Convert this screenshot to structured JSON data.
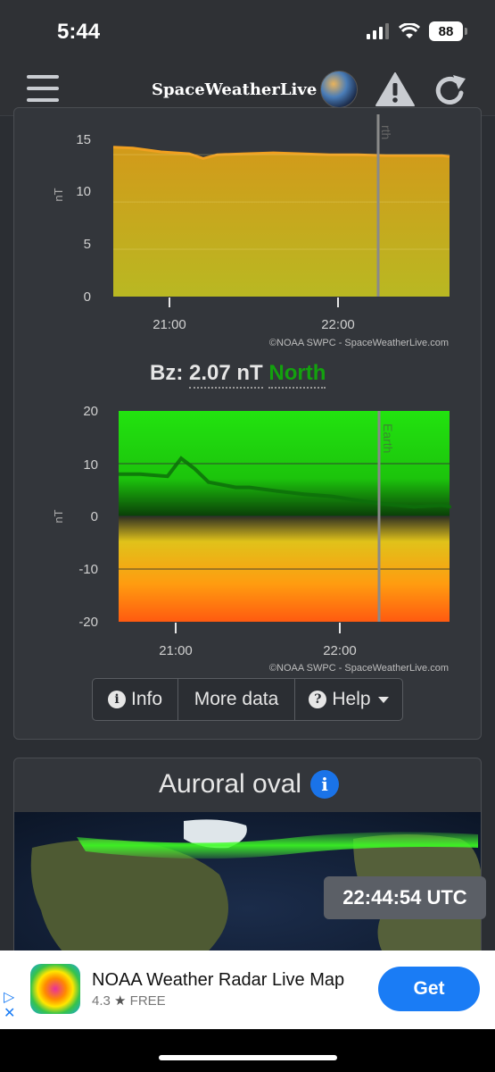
{
  "status_bar": {
    "time": "5:44",
    "battery": "88"
  },
  "header": {
    "brand": "SpaceWeatherLive"
  },
  "bt_chart": {
    "y_ticks": [
      "15",
      "10",
      "5",
      "0"
    ],
    "y_label": "nT",
    "x_ticks": [
      "21:00",
      "22:00"
    ],
    "earth_label": "rth",
    "credit": "©NOAA SWPC - SpaceWeatherLive.com"
  },
  "bz": {
    "label": "Bz:",
    "value": "2.07 nT",
    "direction": "North"
  },
  "bz_chart": {
    "y_ticks": [
      "20",
      "10",
      "0",
      "-10",
      "-20"
    ],
    "y_label": "nT",
    "x_ticks": [
      "21:00",
      "22:00"
    ],
    "earth_label": "Earth",
    "credit": "©NOAA SWPC - SpaceWeatherLive.com"
  },
  "buttons": {
    "info": "Info",
    "more_data": "More data",
    "help": "Help"
  },
  "aurora": {
    "title": "Auroral oval",
    "utc": "22:44:54 UTC"
  },
  "ad": {
    "title": "NOAA Weather Radar Live Map",
    "rating": "4.3",
    "price": "FREE",
    "cta": "Get"
  },
  "chart_data": [
    {
      "type": "area",
      "ylabel": "nT",
      "ylim": [
        0,
        17
      ],
      "x_ticks": [
        "21:00",
        "22:00"
      ],
      "x": [
        "20:37",
        "20:47",
        "20:57",
        "21:07",
        "21:12",
        "21:17",
        "21:27",
        "21:37",
        "21:47",
        "21:57",
        "22:07",
        "22:17",
        "22:27",
        "22:37",
        "22:47",
        "22:55"
      ],
      "series": [
        {
          "values": [
            15.8,
            15.7,
            15.3,
            15.1,
            14.6,
            15.0,
            15.1,
            15.2,
            15.1,
            15.0,
            15.0,
            14.9,
            14.9,
            14.9,
            14.8,
            14.8
          ]
        }
      ],
      "annotations": [
        "rth"
      ]
    },
    {
      "type": "line",
      "ylabel": "nT",
      "ylim": [
        -20,
        20
      ],
      "x_ticks": [
        "21:00",
        "22:00"
      ],
      "x": [
        "20:37",
        "20:47",
        "20:57",
        "21:02",
        "21:07",
        "21:12",
        "21:17",
        "21:22",
        "21:27",
        "21:37",
        "21:47",
        "21:57",
        "22:07",
        "22:17",
        "22:27",
        "22:37",
        "22:47",
        "22:55"
      ],
      "series": [
        {
          "values": [
            8.0,
            8.0,
            7.6,
            11.0,
            9.0,
            6.5,
            6.0,
            5.5,
            5.5,
            4.8,
            4.2,
            3.8,
            3.0,
            2.3,
            1.8,
            2.1,
            1.9,
            2.07
          ]
        }
      ],
      "annotations": [
        "Earth"
      ]
    }
  ],
  "colors": {
    "accent": "#1a7cf5",
    "north": "#13a10e",
    "bt_fill": "#c8a21f",
    "bt_line": "#f0a020"
  },
  "icons": [
    "menu-icon",
    "warning-icon",
    "refresh-icon",
    "globe-icon",
    "info-icon",
    "help-icon",
    "signal-icon",
    "wifi-icon"
  ]
}
